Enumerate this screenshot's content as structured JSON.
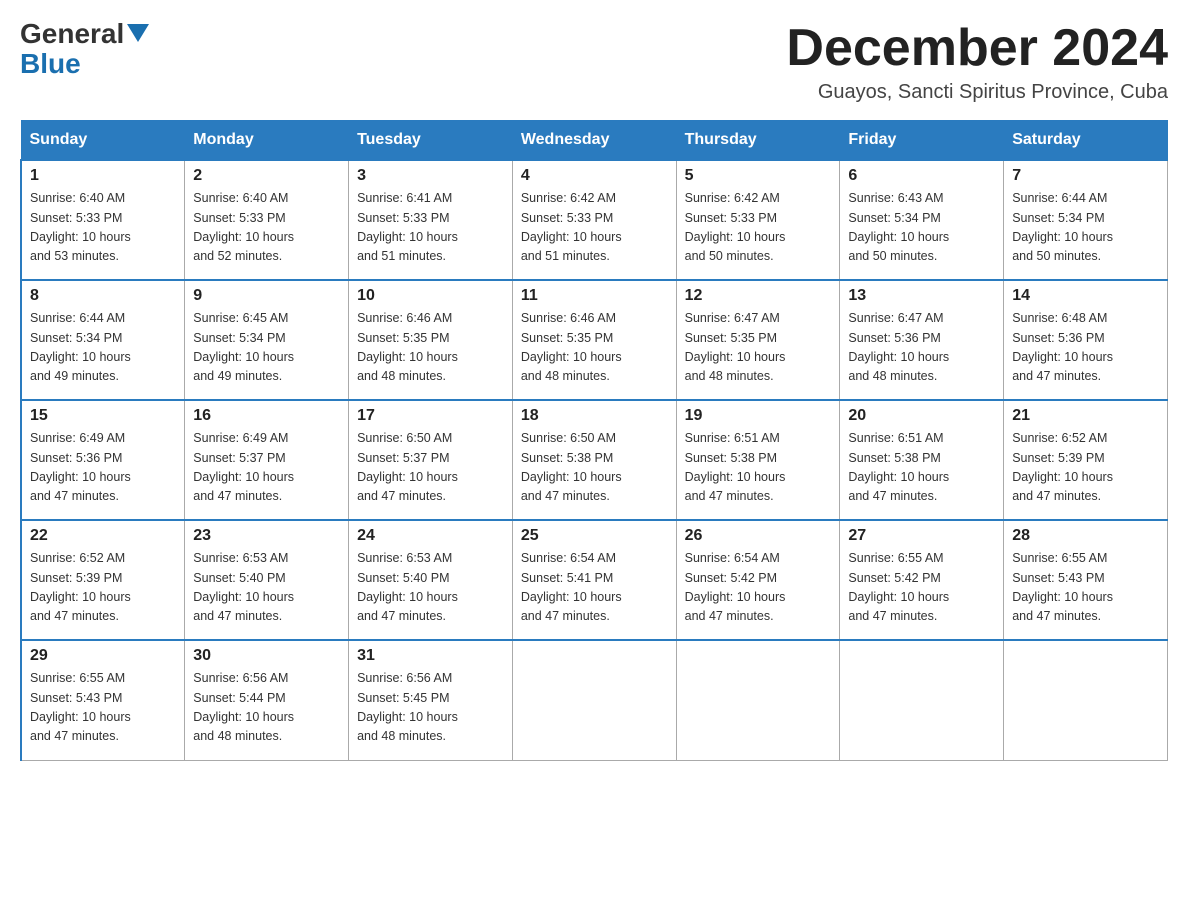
{
  "header": {
    "logo_line1": "General",
    "logo_line2": "Blue",
    "month": "December 2024",
    "location": "Guayos, Sancti Spiritus Province, Cuba"
  },
  "days_of_week": [
    "Sunday",
    "Monday",
    "Tuesday",
    "Wednesday",
    "Thursday",
    "Friday",
    "Saturday"
  ],
  "weeks": [
    [
      {
        "num": "1",
        "sunrise": "6:40 AM",
        "sunset": "5:33 PM",
        "daylight": "10 hours and 53 minutes."
      },
      {
        "num": "2",
        "sunrise": "6:40 AM",
        "sunset": "5:33 PM",
        "daylight": "10 hours and 52 minutes."
      },
      {
        "num": "3",
        "sunrise": "6:41 AM",
        "sunset": "5:33 PM",
        "daylight": "10 hours and 51 minutes."
      },
      {
        "num": "4",
        "sunrise": "6:42 AM",
        "sunset": "5:33 PM",
        "daylight": "10 hours and 51 minutes."
      },
      {
        "num": "5",
        "sunrise": "6:42 AM",
        "sunset": "5:33 PM",
        "daylight": "10 hours and 50 minutes."
      },
      {
        "num": "6",
        "sunrise": "6:43 AM",
        "sunset": "5:34 PM",
        "daylight": "10 hours and 50 minutes."
      },
      {
        "num": "7",
        "sunrise": "6:44 AM",
        "sunset": "5:34 PM",
        "daylight": "10 hours and 50 minutes."
      }
    ],
    [
      {
        "num": "8",
        "sunrise": "6:44 AM",
        "sunset": "5:34 PM",
        "daylight": "10 hours and 49 minutes."
      },
      {
        "num": "9",
        "sunrise": "6:45 AM",
        "sunset": "5:34 PM",
        "daylight": "10 hours and 49 minutes."
      },
      {
        "num": "10",
        "sunrise": "6:46 AM",
        "sunset": "5:35 PM",
        "daylight": "10 hours and 48 minutes."
      },
      {
        "num": "11",
        "sunrise": "6:46 AM",
        "sunset": "5:35 PM",
        "daylight": "10 hours and 48 minutes."
      },
      {
        "num": "12",
        "sunrise": "6:47 AM",
        "sunset": "5:35 PM",
        "daylight": "10 hours and 48 minutes."
      },
      {
        "num": "13",
        "sunrise": "6:47 AM",
        "sunset": "5:36 PM",
        "daylight": "10 hours and 48 minutes."
      },
      {
        "num": "14",
        "sunrise": "6:48 AM",
        "sunset": "5:36 PM",
        "daylight": "10 hours and 47 minutes."
      }
    ],
    [
      {
        "num": "15",
        "sunrise": "6:49 AM",
        "sunset": "5:36 PM",
        "daylight": "10 hours and 47 minutes."
      },
      {
        "num": "16",
        "sunrise": "6:49 AM",
        "sunset": "5:37 PM",
        "daylight": "10 hours and 47 minutes."
      },
      {
        "num": "17",
        "sunrise": "6:50 AM",
        "sunset": "5:37 PM",
        "daylight": "10 hours and 47 minutes."
      },
      {
        "num": "18",
        "sunrise": "6:50 AM",
        "sunset": "5:38 PM",
        "daylight": "10 hours and 47 minutes."
      },
      {
        "num": "19",
        "sunrise": "6:51 AM",
        "sunset": "5:38 PM",
        "daylight": "10 hours and 47 minutes."
      },
      {
        "num": "20",
        "sunrise": "6:51 AM",
        "sunset": "5:38 PM",
        "daylight": "10 hours and 47 minutes."
      },
      {
        "num": "21",
        "sunrise": "6:52 AM",
        "sunset": "5:39 PM",
        "daylight": "10 hours and 47 minutes."
      }
    ],
    [
      {
        "num": "22",
        "sunrise": "6:52 AM",
        "sunset": "5:39 PM",
        "daylight": "10 hours and 47 minutes."
      },
      {
        "num": "23",
        "sunrise": "6:53 AM",
        "sunset": "5:40 PM",
        "daylight": "10 hours and 47 minutes."
      },
      {
        "num": "24",
        "sunrise": "6:53 AM",
        "sunset": "5:40 PM",
        "daylight": "10 hours and 47 minutes."
      },
      {
        "num": "25",
        "sunrise": "6:54 AM",
        "sunset": "5:41 PM",
        "daylight": "10 hours and 47 minutes."
      },
      {
        "num": "26",
        "sunrise": "6:54 AM",
        "sunset": "5:42 PM",
        "daylight": "10 hours and 47 minutes."
      },
      {
        "num": "27",
        "sunrise": "6:55 AM",
        "sunset": "5:42 PM",
        "daylight": "10 hours and 47 minutes."
      },
      {
        "num": "28",
        "sunrise": "6:55 AM",
        "sunset": "5:43 PM",
        "daylight": "10 hours and 47 minutes."
      }
    ],
    [
      {
        "num": "29",
        "sunrise": "6:55 AM",
        "sunset": "5:43 PM",
        "daylight": "10 hours and 47 minutes."
      },
      {
        "num": "30",
        "sunrise": "6:56 AM",
        "sunset": "5:44 PM",
        "daylight": "10 hours and 48 minutes."
      },
      {
        "num": "31",
        "sunrise": "6:56 AM",
        "sunset": "5:45 PM",
        "daylight": "10 hours and 48 minutes."
      },
      null,
      null,
      null,
      null
    ]
  ],
  "labels": {
    "sunrise": "Sunrise:",
    "sunset": "Sunset:",
    "daylight": "Daylight:"
  }
}
